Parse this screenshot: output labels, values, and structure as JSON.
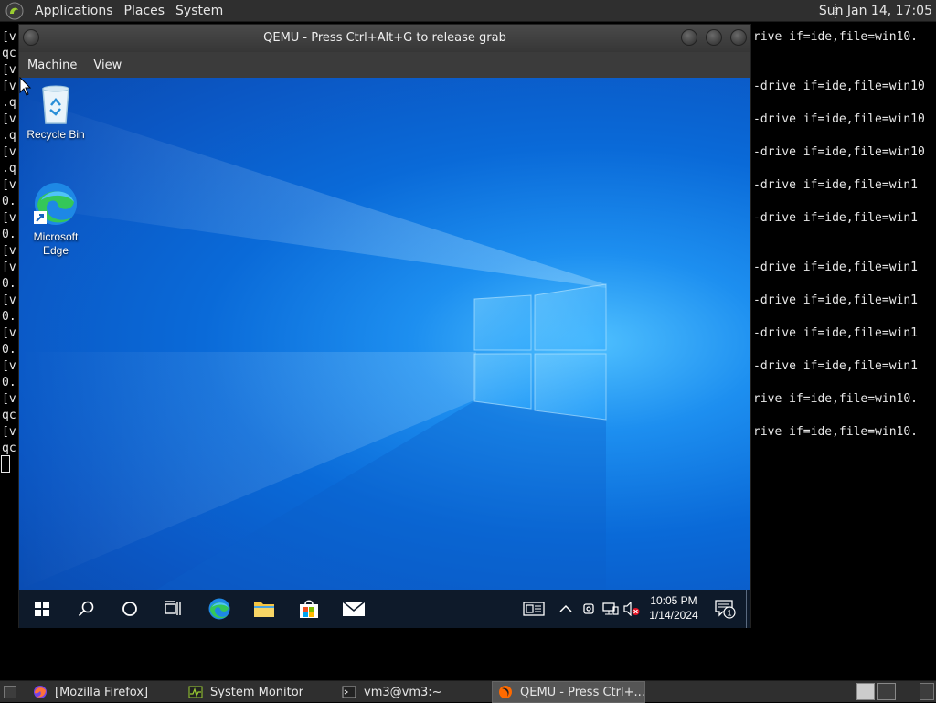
{
  "top_panel": {
    "menus": [
      "Applications",
      "Places",
      "System"
    ],
    "clock": "Sun Jan 14, 17:05"
  },
  "terminal": {
    "lines": [
      "[v",
      "qc",
      "[v",
      "[v",
      ".q",
      "[v",
      ".q",
      "[v",
      ".q",
      "[v",
      "0.",
      "[v",
      "0.",
      "[v",
      "[v",
      "0.",
      "[v",
      "0.",
      "[v",
      "0.",
      "[v",
      "0.",
      "[v",
      "qc",
      "[v",
      "qc"
    ],
    "right_lines": [
      "rive if=ide,file=win10.",
      "-drive if=ide,file=win10",
      "-drive if=ide,file=win10",
      "-drive if=ide,file=win10",
      "-drive if=ide,file=win1",
      "-drive if=ide,file=win1",
      "-drive if=ide,file=win1",
      "-drive if=ide,file=win1",
      "-drive if=ide,file=win1",
      "-drive if=ide,file=win1",
      "rive if=ide,file=win10.",
      "rive if=ide,file=win10."
    ]
  },
  "qemu": {
    "title": "QEMU - Press Ctrl+Alt+G to release grab",
    "menus": [
      "Machine",
      "View"
    ]
  },
  "desktop": {
    "icons": [
      {
        "label": "Recycle Bin"
      },
      {
        "label": "Microsoft\nEdge"
      }
    ]
  },
  "win_taskbar": {
    "time": "10:05 PM",
    "date": "1/14/2024",
    "notification_count": "1"
  },
  "bottom_panel": {
    "tasks": [
      "[Mozilla Firefox]",
      "System Monitor",
      "vm3@vm3:~",
      "QEMU - Press Ctrl+..."
    ]
  },
  "colors": {
    "panel_bg": "#2f2f2f",
    "win_taskbar_bg": "#0e1a2a",
    "desktop_blue": "#0a6ad8"
  }
}
